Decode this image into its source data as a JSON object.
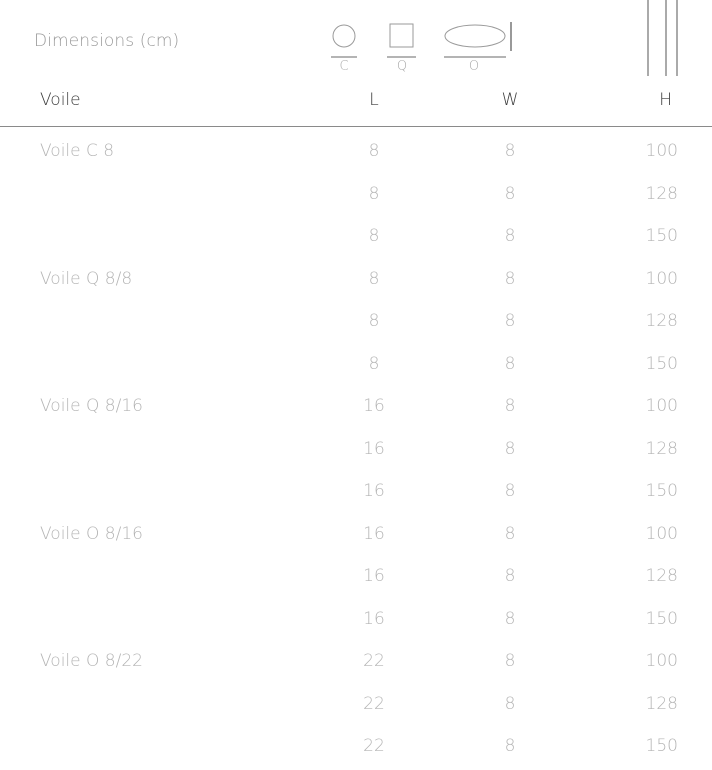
{
  "header": {
    "dimensions_label": "Dimensions (cm)",
    "shapes": [
      {
        "label": "C",
        "icon": "circle-icon"
      },
      {
        "label": "Q",
        "icon": "square-icon"
      },
      {
        "label": "O",
        "icon": "oval-icon"
      }
    ],
    "height_icon": "height-lines-icon"
  },
  "table": {
    "columns": {
      "name": "Voile",
      "l": "L",
      "w": "W",
      "h": "H"
    },
    "rows": [
      {
        "name": "Voile C 8",
        "l": "8",
        "w": "8",
        "h": "100"
      },
      {
        "name": "",
        "l": "8",
        "w": "8",
        "h": "128"
      },
      {
        "name": "",
        "l": "8",
        "w": "8",
        "h": "150"
      },
      {
        "name": "Voile Q 8/8",
        "l": "8",
        "w": "8",
        "h": "100"
      },
      {
        "name": "",
        "l": "8",
        "w": "8",
        "h": "128"
      },
      {
        "name": "",
        "l": "8",
        "w": "8",
        "h": "150"
      },
      {
        "name": "Voile Q 8/16",
        "l": "16",
        "w": "8",
        "h": "100"
      },
      {
        "name": "",
        "l": "16",
        "w": "8",
        "h": "128"
      },
      {
        "name": "",
        "l": "16",
        "w": "8",
        "h": "150"
      },
      {
        "name": "Voile O 8/16",
        "l": "16",
        "w": "8",
        "h": "100"
      },
      {
        "name": "",
        "l": "16",
        "w": "8",
        "h": "128"
      },
      {
        "name": "",
        "l": "16",
        "w": "8",
        "h": "150"
      },
      {
        "name": "Voile O 8/22",
        "l": "22",
        "w": "8",
        "h": "100"
      },
      {
        "name": "",
        "l": "22",
        "w": "8",
        "h": "128"
      },
      {
        "name": "",
        "l": "22",
        "w": "8",
        "h": "150"
      }
    ]
  }
}
